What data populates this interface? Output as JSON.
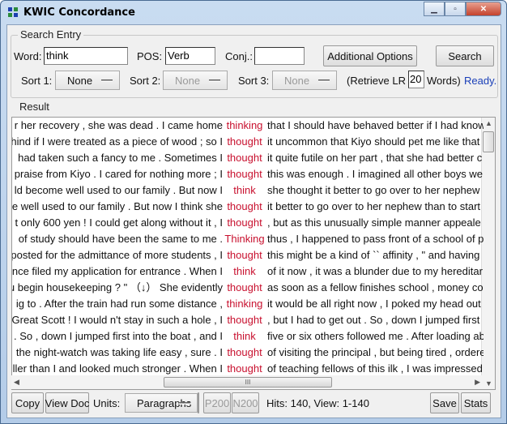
{
  "window": {
    "title": "KWIC Concordance",
    "controls": [
      "minimize",
      "maximize",
      "close"
    ]
  },
  "search_entry": {
    "legend": "Search Entry",
    "word_label": "Word:",
    "word_value": "think",
    "pos_label": "POS:",
    "pos_value": "Verb",
    "conj_label": "Conj.:",
    "conj_value": "",
    "additional_options": "Additional Options",
    "search": "Search",
    "sort1_label": "Sort 1:",
    "sort1_value": "None",
    "sort2_label": "Sort 2:",
    "sort2_value": "None",
    "sort3_label": "Sort 3:",
    "sort3_value": "None",
    "retrieve_prefix": "(Retrieve LR",
    "retrieve_value": "20",
    "retrieve_suffix": "Words)",
    "status": "Ready."
  },
  "result": {
    "legend": "Result",
    "rows": [
      {
        "left": "r her recovery , she was dead . I came home",
        "kw": "thinking",
        "right": "that I should have behaved better if I had know"
      },
      {
        "left": "hind if I were treated as a piece of wood ; so I",
        "kw": "thought",
        "right": "it uncommon that Kiyo should pet me like that"
      },
      {
        "left": "had taken such a fancy to me . Sometimes I",
        "kw": "thought",
        "right": "it quite futile on her part , that she had better c"
      },
      {
        "left": "praise from Kiyo . I cared for nothing more ; I",
        "kw": "thought",
        "right": "this was enough . I imagined all other boys we"
      },
      {
        "left": "ld become well used to our family . But now I",
        "kw": "think",
        "right": "she thought it better to go over to her nephew"
      },
      {
        "left": "e well used to our family . But now I think she",
        "kw": "thought",
        "right": "it better to go over to her nephew than to start"
      },
      {
        "left": "t only 600 yen ! I could get along without it , I",
        "kw": "thought",
        "right": ", but as this unusually simple manner appeale"
      },
      {
        "left": "of study should have been the same to me .",
        "kw": "Thinking",
        "right": "thus , I happened to pass front of a school of p"
      },
      {
        "left": "posted for the admittance of more students , I",
        "kw": "thought",
        "right": "this might be a kind of `` affinity , \" and having"
      },
      {
        "left": "nce filed my application for entrance . When I",
        "kw": "think",
        "right": "of it now , it was a blunder due to my hereditar"
      },
      {
        "left": "u begin housekeeping ? \" （↓）  She evidently",
        "kw": "thought",
        "right": "as soon as a fellow finishes school , money co"
      },
      {
        "left": "ig to . After the train had run some distance ,",
        "kw": "thinking",
        "right": "it would be all right now , I poked my head out"
      },
      {
        "left": "Great Scott ! I would n't stay in such a hole , I",
        "kw": "thought",
        "right": ", but I had to get out . So , down I jumped first"
      },
      {
        "left": ". So , down I jumped first into the boat , and I",
        "kw": "think",
        "right": "five or six others followed me . After loading ab"
      },
      {
        "left": "the night-watch was taking life easy , sure . I",
        "kw": "thought",
        "right": "of visiting the principal , but being tired , ordere"
      },
      {
        "left": "ller than I and looked much stronger . When I",
        "kw": "thought",
        "right": "of teaching fellows of this ilk , I was impressed"
      }
    ],
    "keyword_color": "#c8102e"
  },
  "bottom": {
    "copy": "Copy",
    "view_doc": "View Doc",
    "units_label": "Units:",
    "units_value": "Paragraphs",
    "p200": "P200",
    "n200": "N200",
    "hits": "Hits: 140, View: 1-140",
    "save": "Save",
    "stats": "Stats"
  }
}
